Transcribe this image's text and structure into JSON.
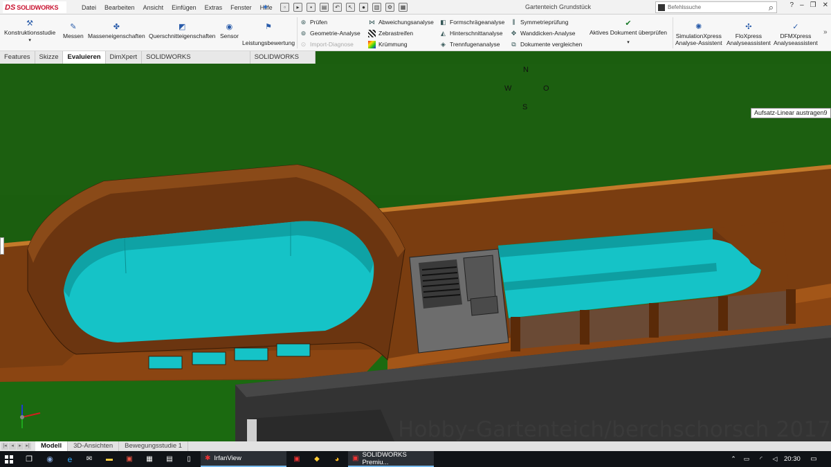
{
  "app": {
    "logo_ds": "DS",
    "logo_name": "SOLIDWORKS",
    "document_title": "Gartenteich Grundstück"
  },
  "menu": [
    "Datei",
    "Bearbeiten",
    "Ansicht",
    "Einfügen",
    "Extras",
    "Fenster",
    "Hilfe"
  ],
  "search": {
    "placeholder": "Befehlssuche"
  },
  "ribbon": {
    "konstruktionsstudie": "Konstruktionsstudie",
    "messen": "Messen",
    "masseneigenschaften": "Masseneigenschaften",
    "querschnitt": "Querschnitteigenschaften",
    "sensor": "Sensor",
    "leistungsbewertung": "Leistungsbewertung",
    "col1": [
      "Prüfen",
      "Geometrie-Analyse",
      "Import-Diagnose"
    ],
    "col2": [
      "Abweichungsanalyse",
      "Zebrastreifen",
      "Krümmung"
    ],
    "col3": [
      "Formschrägeanalyse",
      "Hinterschnittanalyse",
      "Trennfugenanalyse"
    ],
    "col4": [
      "Symmetrieprüfung",
      "Wanddicken-Analyse",
      "Dokumente vergleichen"
    ],
    "aktives_dokument": "Aktives Dokument überprüfen",
    "simulation_l1": "SimulationXpress",
    "simulation_l2": "Analyse-Assistent",
    "flo_l1": "FloXpress",
    "flo_l2": "Analyseassistent",
    "dfm_l1": "DFMXpress",
    "dfm_l2": "Analyseassistent"
  },
  "command_tabs": [
    "Features",
    "Skizze",
    "Evaluieren",
    "DimXpert",
    "SOLIDWORKS Zusatzanwendungen",
    "SOLIDWORKS MBD"
  ],
  "active_command_tab": "Evaluieren",
  "viewport": {
    "compass": {
      "n": "N",
      "w": "W",
      "o": "O",
      "s": "S"
    },
    "tooltip": "Aufsatz-Linear austragen9",
    "watermark": "Hobby-Gartenteich/berchschorsch 2017"
  },
  "bottom_tabs": [
    "Modell",
    "3D-Ansichten",
    "Bewegungsstudie 1"
  ],
  "taskbar": {
    "irfanview": "IrfanView",
    "solidworks": "SOLIDWORKS Premiu...",
    "time": "20:30"
  },
  "colors": {
    "grass": "#1b5e0f",
    "wood": "#7b3f12",
    "water": "#14c2c6",
    "concrete": "#3c3c3c",
    "accent": "#c8102e"
  }
}
